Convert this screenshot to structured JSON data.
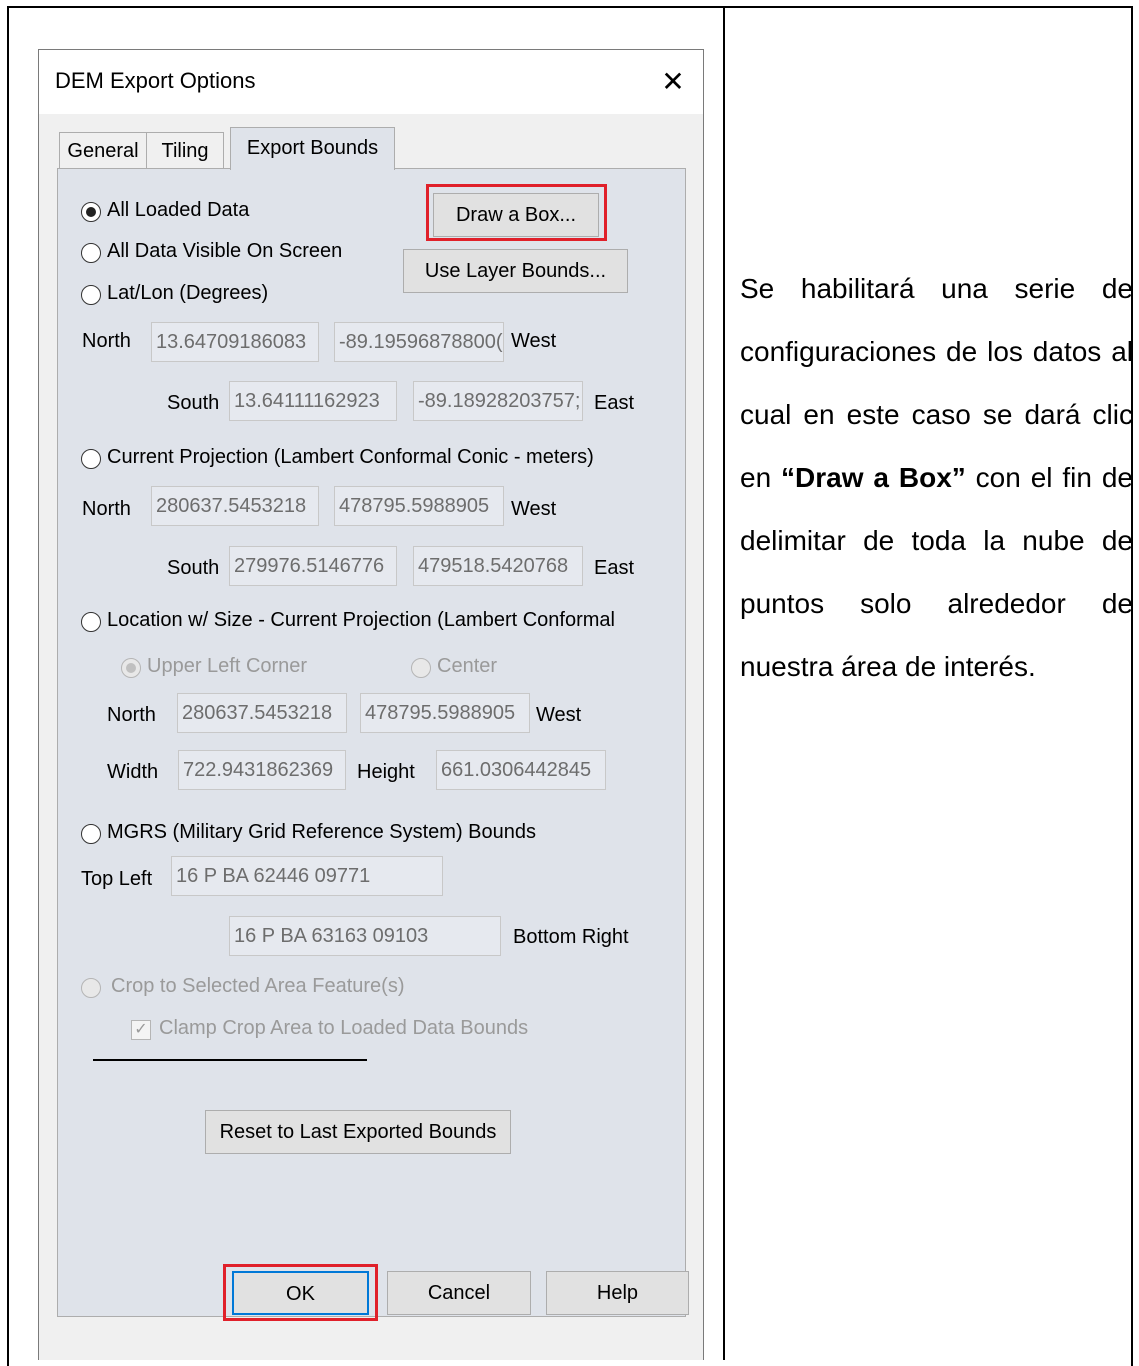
{
  "dialog": {
    "title": "DEM Export Options",
    "close_glyph": "✕",
    "tabs": [
      "General",
      "Tiling",
      "Export Bounds"
    ],
    "active_tab": "Export Bounds"
  },
  "options": {
    "all_loaded": "All Loaded Data",
    "all_visible": "All Data Visible On Screen",
    "latlon": "Lat/Lon (Degrees)",
    "current_proj": "Current Projection (Lambert Conformal Conic - meters)",
    "location_size": "Location w/ Size - Current Projection (Lambert Conformal",
    "mgrs": "MGRS (Military Grid Reference System) Bounds",
    "crop": "Crop to Selected Area Feature(s)"
  },
  "buttons": {
    "draw_box": "Draw a Box...",
    "use_layer": "Use Layer Bounds...",
    "reset": "Reset to Last Exported Bounds",
    "ok": "OK",
    "cancel": "Cancel",
    "help": "Help"
  },
  "latlon": {
    "north_label": "North",
    "north": "13.64709186083",
    "west": "-89.19596878800(",
    "west_label": "West",
    "south_label": "South",
    "south": "13.64111162923",
    "east": "-89.18928203757;",
    "east_label": "East"
  },
  "proj": {
    "north_label": "North",
    "north": "280637.5453218",
    "west": "478795.5988905",
    "west_label": "West",
    "south_label": "South",
    "south": "279976.5146776",
    "east": "479518.5420768",
    "east_label": "East"
  },
  "locsize": {
    "upper_left": "Upper Left Corner",
    "center": "Center",
    "north_label": "North",
    "north": "280637.5453218",
    "west": "478795.5988905",
    "west_label": "West",
    "width_label": "Width",
    "width": "722.9431862369",
    "height_label": "Height",
    "height": "661.0306442845"
  },
  "mgrs": {
    "top_left_label": "Top Left",
    "top_left": "16 P BA 62446 09771",
    "bottom_right": "16 P BA 63163 09103",
    "bottom_right_label": "Bottom Right"
  },
  "clamp_label": "Clamp Crop Area to Loaded Data Bounds",
  "description": {
    "text_before": "Se habilitará una serie de configuraciones de los datos al cual en este caso se dará clic en ",
    "bold": "“Draw a Box”",
    "text_after": " con el fin de delimitar de toda la nube de puntos solo alrededor de nuestra área de interés."
  },
  "colors": {
    "highlight": "#e0202a",
    "panel": "#dfe3ea",
    "focus": "#0078d7"
  }
}
